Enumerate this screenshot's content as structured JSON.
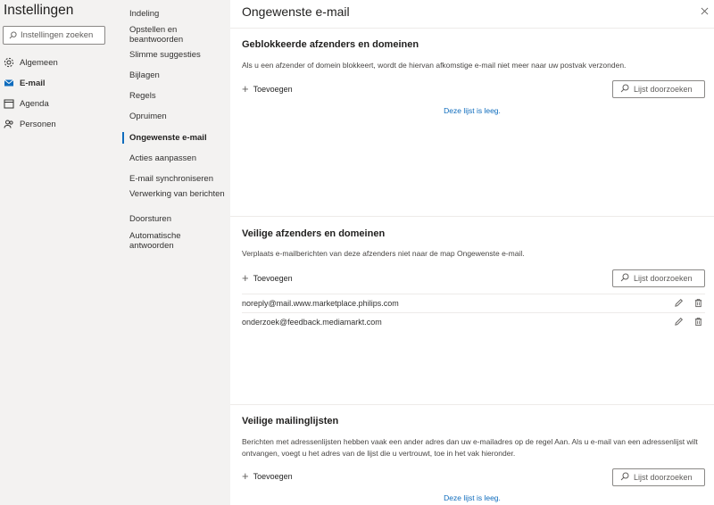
{
  "settings": {
    "title": "Instellingen",
    "search_placeholder": "Instellingen zoeken",
    "categories": [
      {
        "label": "Algemeen",
        "icon": "gear-icon"
      },
      {
        "label": "E-mail",
        "icon": "mail-icon",
        "active": true
      },
      {
        "label": "Agenda",
        "icon": "calendar-icon"
      },
      {
        "label": "Personen",
        "icon": "people-icon"
      }
    ]
  },
  "nav": {
    "items": [
      {
        "label": "Indeling"
      },
      {
        "label": "Opstellen en beantwoorden"
      },
      {
        "label": "Slimme suggesties"
      },
      {
        "label": "Bijlagen"
      },
      {
        "label": "Regels"
      },
      {
        "label": "Opruimen"
      },
      {
        "label": "Ongewenste e-mail",
        "active": true
      },
      {
        "label": "Acties aanpassen"
      },
      {
        "label": "E-mail synchroniseren"
      },
      {
        "label": "Verwerking van berichten"
      },
      {
        "label": "Doorsturen"
      },
      {
        "label": "Automatische antwoorden"
      }
    ]
  },
  "main": {
    "title": "Ongewenste e-mail",
    "sections": {
      "blocked": {
        "title": "Geblokkeerde afzenders en domeinen",
        "description": "Als u een afzender of domein blokkeert, wordt de hiervan afkomstige e-mail niet meer naar uw postvak verzonden.",
        "add_label": "Toevoegen",
        "search_label": "Lijst doorzoeken",
        "empty_label": "Deze lijst is leeg."
      },
      "safe": {
        "title": "Veilige afzenders en domeinen",
        "description": "Verplaats e-mailberichten van deze afzenders niet naar de map Ongewenste e-mail.",
        "add_label": "Toevoegen",
        "search_label": "Lijst doorzoeken",
        "entries": [
          "noreply@mail.www.marketplace.philips.com",
          "onderzoek@feedback.mediamarkt.com"
        ]
      },
      "mailinglists": {
        "title": "Veilige mailinglijsten",
        "description": "Berichten met adressenlijsten hebben vaak een ander adres dan uw e-mailadres op de regel Aan. Als u e-mail van een adressenlijst wilt ontvangen, voegt u het adres van de lijst die u vertrouwt, toe in het vak hieronder.",
        "add_label": "Toevoegen",
        "search_label": "Lijst doorzoeken",
        "empty_label": "Deze lijst is leeg."
      }
    }
  },
  "colors": {
    "accent": "#0f6cbd",
    "sidebar_bg": "#f3f2f1"
  }
}
